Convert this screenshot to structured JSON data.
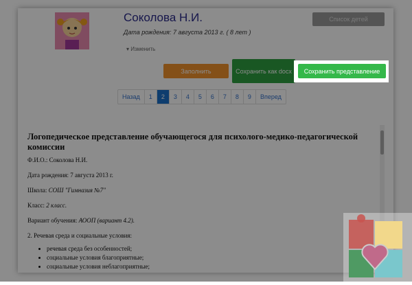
{
  "profile": {
    "name": "Соколова Н.И.",
    "birth_date": "Дата рождения: 7 августа 2013 г. ( 8 лет )",
    "edit_label": "▾ Изменить"
  },
  "buttons": {
    "kids_list": "Список детей",
    "fill": "Заполнить",
    "save_docx": "Сохранить как docx",
    "save_report": "Сохранить представление"
  },
  "pagination": {
    "prev": "Назад",
    "pages": [
      "1",
      "2",
      "3",
      "4",
      "5",
      "6",
      "7",
      "8",
      "9"
    ],
    "active": "2",
    "next": "Вперед"
  },
  "document": {
    "title": "Логопедическое представление обучающегося для психолого-медико-педагогической комиссии",
    "fio_label": "Ф.И.О.: ",
    "fio": "Соколова Н.И.",
    "dob": "Дата рождения: 7 августа 2013 г.",
    "school_label": "Школа: ",
    "school": "СОШ \"Гимназия №7\"",
    "class_label": "Класс: ",
    "class": "2 класс.",
    "variant_label": "Вариант обучения: ",
    "variant": "АООП (вариант 4.2).",
    "section2": "2. Речевая среда и социальные условия:",
    "items": [
      "речевая среда без особенностей;",
      "социальные условия благоприятные;",
      "социальные условия неблагоприятные;"
    ]
  },
  "colors": {
    "overlay": "#000000",
    "highlight": "#ffffff",
    "save_button": "#35b84a",
    "fill_button": "#f0922c",
    "docx_button": "#2f9e40",
    "active_page": "#1b6fc8"
  }
}
